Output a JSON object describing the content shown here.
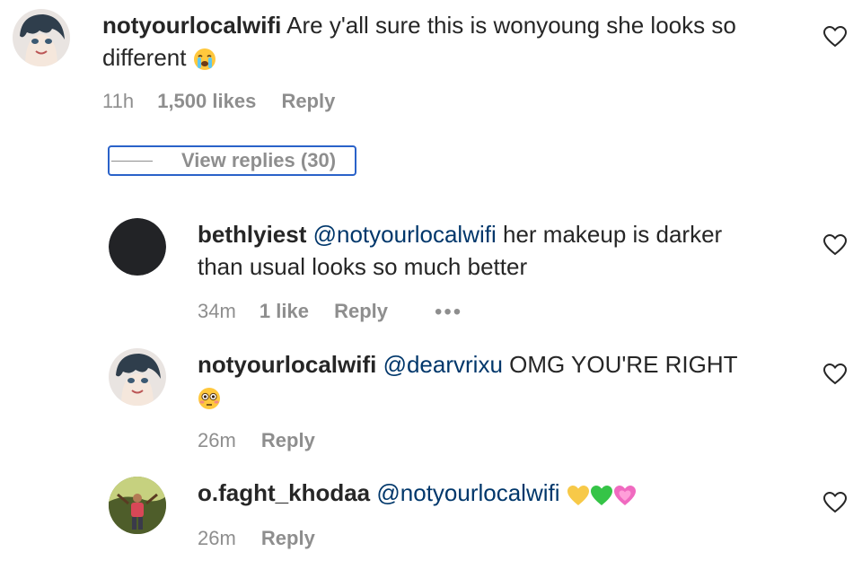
{
  "comment": {
    "username": "notyourlocalwifi",
    "text": "Are y'all sure this is wonyoung she looks so different",
    "time": "11h",
    "likes": "1,500 likes",
    "reply_label": "Reply"
  },
  "view_replies": {
    "label": "View replies (30)"
  },
  "replies": [
    {
      "username": "bethlyiest",
      "mention": "@notyourlocalwifi",
      "text_line1": "her makeup is darker",
      "text_line2": "than usual looks so much better",
      "time": "34m",
      "likes": "1 like",
      "reply_label": "Reply",
      "more": "•••"
    },
    {
      "username": "notyourlocalwifi",
      "mention": "@dearvrixu",
      "text": "OMG YOU'RE RIGHT",
      "time": "26m",
      "reply_label": "Reply"
    },
    {
      "username": "o.faght_khodaa",
      "mention": "@notyourlocalwifi",
      "time": "26m",
      "reply_label": "Reply"
    }
  ],
  "colors": {
    "text": "#262626",
    "meta": "#8e8e8e",
    "mention": "#00376b",
    "focus_outline": "#2a62c9"
  },
  "icons": {
    "heart": "heart-outline-icon",
    "crying": "loudly-crying-face-emoji",
    "flushed": "flushed-face-emoji",
    "yellow_heart": "yellow-heart-emoji",
    "green_heart": "green-heart-emoji",
    "pink_heart": "growing-heart-emoji"
  }
}
